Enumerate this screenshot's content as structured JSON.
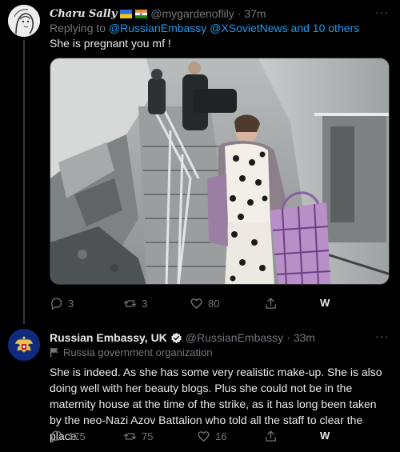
{
  "tweet1": {
    "display_name": "Charu Sally",
    "handle": "@mygardenoflily",
    "time": "· 37m",
    "reply_prefix": "Replying to ",
    "reply_users": "@RussianEmbassy @XSovietNews",
    "reply_suffix": " and 10 others",
    "text": "She is pregnant you mf !",
    "stats": {
      "replies": "3",
      "retweets": "3",
      "likes": "80"
    },
    "extra_label": "W"
  },
  "tweet2": {
    "display_name": "Russian Embassy, UK",
    "handle": "@RussianEmbassy",
    "time": "· 33m",
    "org_label": "Russia government organization",
    "text": "She is indeed. As she has some very realistic make-up. She is also doing well with her beauty blogs. Plus she could not be in the maternity house at the time of the strike, as it has long been taken by the neo-Nazi Azov Battalion who told all the staff to clear the place.",
    "stats": {
      "replies": "175",
      "retweets": "75",
      "likes": "16"
    },
    "extra_label": "W"
  },
  "more_icon": "···",
  "colors": {
    "link": "#1d9bf0",
    "muted": "#71767b",
    "text": "#e7e9ea",
    "background": "#000000"
  }
}
